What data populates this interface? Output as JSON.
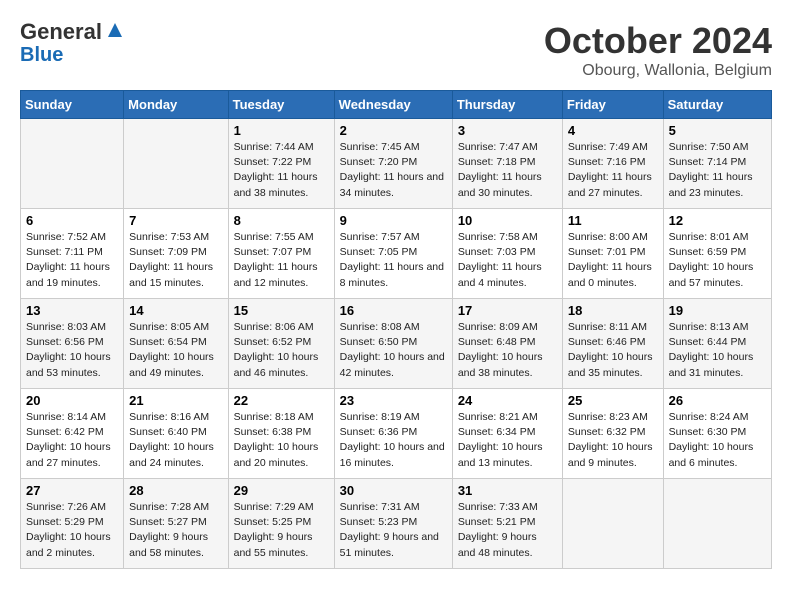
{
  "header": {
    "logo_line1": "General",
    "logo_line2": "Blue",
    "month_title": "October 2024",
    "location": "Obourg, Wallonia, Belgium"
  },
  "days_of_week": [
    "Sunday",
    "Monday",
    "Tuesday",
    "Wednesday",
    "Thursday",
    "Friday",
    "Saturday"
  ],
  "weeks": [
    [
      {
        "num": "",
        "info": ""
      },
      {
        "num": "",
        "info": ""
      },
      {
        "num": "1",
        "info": "Sunrise: 7:44 AM\nSunset: 7:22 PM\nDaylight: 11 hours and 38 minutes."
      },
      {
        "num": "2",
        "info": "Sunrise: 7:45 AM\nSunset: 7:20 PM\nDaylight: 11 hours and 34 minutes."
      },
      {
        "num": "3",
        "info": "Sunrise: 7:47 AM\nSunset: 7:18 PM\nDaylight: 11 hours and 30 minutes."
      },
      {
        "num": "4",
        "info": "Sunrise: 7:49 AM\nSunset: 7:16 PM\nDaylight: 11 hours and 27 minutes."
      },
      {
        "num": "5",
        "info": "Sunrise: 7:50 AM\nSunset: 7:14 PM\nDaylight: 11 hours and 23 minutes."
      }
    ],
    [
      {
        "num": "6",
        "info": "Sunrise: 7:52 AM\nSunset: 7:11 PM\nDaylight: 11 hours and 19 minutes."
      },
      {
        "num": "7",
        "info": "Sunrise: 7:53 AM\nSunset: 7:09 PM\nDaylight: 11 hours and 15 minutes."
      },
      {
        "num": "8",
        "info": "Sunrise: 7:55 AM\nSunset: 7:07 PM\nDaylight: 11 hours and 12 minutes."
      },
      {
        "num": "9",
        "info": "Sunrise: 7:57 AM\nSunset: 7:05 PM\nDaylight: 11 hours and 8 minutes."
      },
      {
        "num": "10",
        "info": "Sunrise: 7:58 AM\nSunset: 7:03 PM\nDaylight: 11 hours and 4 minutes."
      },
      {
        "num": "11",
        "info": "Sunrise: 8:00 AM\nSunset: 7:01 PM\nDaylight: 11 hours and 0 minutes."
      },
      {
        "num": "12",
        "info": "Sunrise: 8:01 AM\nSunset: 6:59 PM\nDaylight: 10 hours and 57 minutes."
      }
    ],
    [
      {
        "num": "13",
        "info": "Sunrise: 8:03 AM\nSunset: 6:56 PM\nDaylight: 10 hours and 53 minutes."
      },
      {
        "num": "14",
        "info": "Sunrise: 8:05 AM\nSunset: 6:54 PM\nDaylight: 10 hours and 49 minutes."
      },
      {
        "num": "15",
        "info": "Sunrise: 8:06 AM\nSunset: 6:52 PM\nDaylight: 10 hours and 46 minutes."
      },
      {
        "num": "16",
        "info": "Sunrise: 8:08 AM\nSunset: 6:50 PM\nDaylight: 10 hours and 42 minutes."
      },
      {
        "num": "17",
        "info": "Sunrise: 8:09 AM\nSunset: 6:48 PM\nDaylight: 10 hours and 38 minutes."
      },
      {
        "num": "18",
        "info": "Sunrise: 8:11 AM\nSunset: 6:46 PM\nDaylight: 10 hours and 35 minutes."
      },
      {
        "num": "19",
        "info": "Sunrise: 8:13 AM\nSunset: 6:44 PM\nDaylight: 10 hours and 31 minutes."
      }
    ],
    [
      {
        "num": "20",
        "info": "Sunrise: 8:14 AM\nSunset: 6:42 PM\nDaylight: 10 hours and 27 minutes."
      },
      {
        "num": "21",
        "info": "Sunrise: 8:16 AM\nSunset: 6:40 PM\nDaylight: 10 hours and 24 minutes."
      },
      {
        "num": "22",
        "info": "Sunrise: 8:18 AM\nSunset: 6:38 PM\nDaylight: 10 hours and 20 minutes."
      },
      {
        "num": "23",
        "info": "Sunrise: 8:19 AM\nSunset: 6:36 PM\nDaylight: 10 hours and 16 minutes."
      },
      {
        "num": "24",
        "info": "Sunrise: 8:21 AM\nSunset: 6:34 PM\nDaylight: 10 hours and 13 minutes."
      },
      {
        "num": "25",
        "info": "Sunrise: 8:23 AM\nSunset: 6:32 PM\nDaylight: 10 hours and 9 minutes."
      },
      {
        "num": "26",
        "info": "Sunrise: 8:24 AM\nSunset: 6:30 PM\nDaylight: 10 hours and 6 minutes."
      }
    ],
    [
      {
        "num": "27",
        "info": "Sunrise: 7:26 AM\nSunset: 5:29 PM\nDaylight: 10 hours and 2 minutes."
      },
      {
        "num": "28",
        "info": "Sunrise: 7:28 AM\nSunset: 5:27 PM\nDaylight: 9 hours and 58 minutes."
      },
      {
        "num": "29",
        "info": "Sunrise: 7:29 AM\nSunset: 5:25 PM\nDaylight: 9 hours and 55 minutes."
      },
      {
        "num": "30",
        "info": "Sunrise: 7:31 AM\nSunset: 5:23 PM\nDaylight: 9 hours and 51 minutes."
      },
      {
        "num": "31",
        "info": "Sunrise: 7:33 AM\nSunset: 5:21 PM\nDaylight: 9 hours and 48 minutes."
      },
      {
        "num": "",
        "info": ""
      },
      {
        "num": "",
        "info": ""
      }
    ]
  ]
}
